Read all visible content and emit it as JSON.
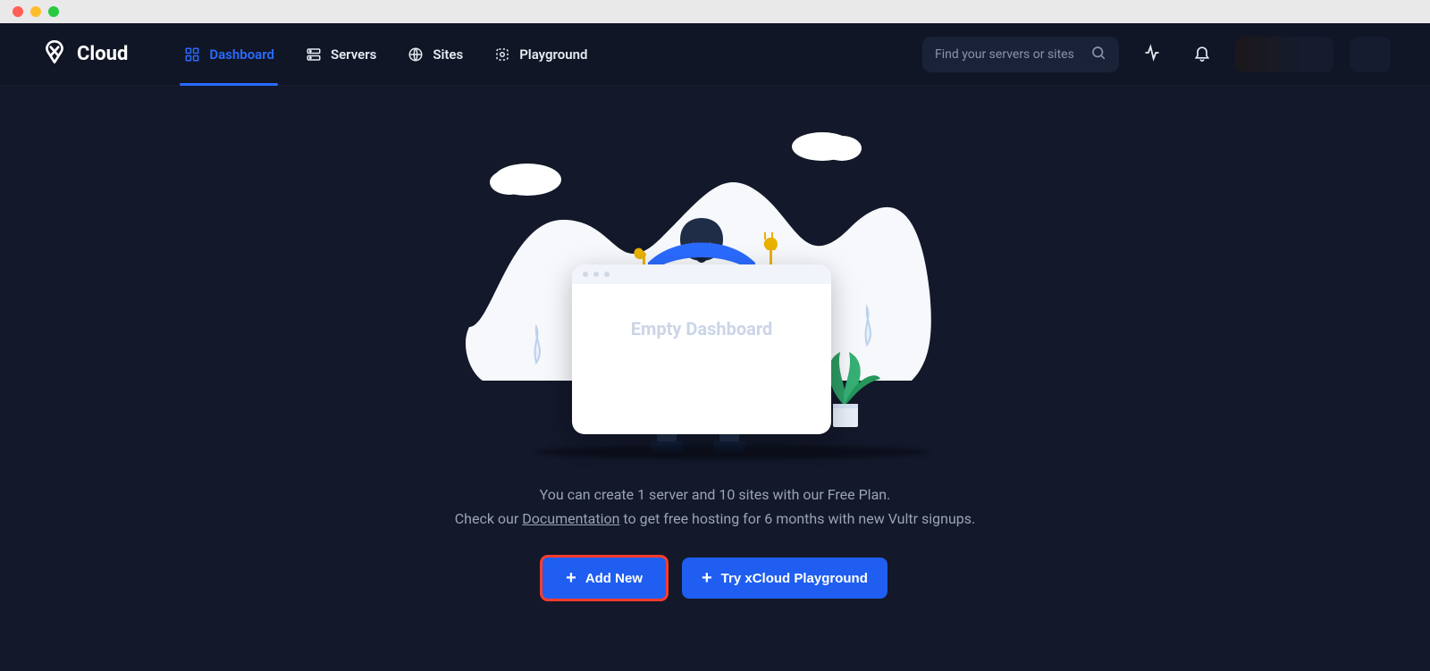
{
  "brand": {
    "name": "Cloud"
  },
  "nav": {
    "dashboard": "Dashboard",
    "servers": "Servers",
    "sites": "Sites",
    "playground": "Playground"
  },
  "search": {
    "placeholder": "Find your servers or sites"
  },
  "hero": {
    "card_title": "Empty Dashboard",
    "desc_line1": "You can create 1 server and 10 sites with our Free Plan.",
    "desc_line2_before": "Check our ",
    "desc_doc_link": "Documentation",
    "desc_line2_after": " to get free hosting for 6 months with new Vultr signups."
  },
  "cta": {
    "add_new": "Add New",
    "try_playground": "Try xCloud Playground"
  }
}
